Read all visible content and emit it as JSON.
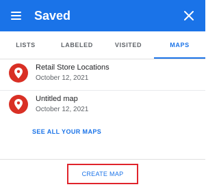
{
  "header": {
    "title": "Saved",
    "menu_icon": "hamburger-menu-icon",
    "close_icon": "close-icon",
    "background_color": "#1a73e8"
  },
  "tabs": [
    {
      "label": "LISTS",
      "active": false
    },
    {
      "label": "LABELED",
      "active": false
    },
    {
      "label": "VISITED",
      "active": false
    },
    {
      "label": "MAPS",
      "active": true
    }
  ],
  "maps": [
    {
      "name": "Retail Store Locations",
      "date": "October 12, 2021",
      "icon": "map-pin-icon"
    },
    {
      "name": "Untitled map",
      "date": "October 12, 2021",
      "icon": "map-pin-icon"
    }
  ],
  "see_all_label": "SEE ALL YOUR MAPS",
  "create_map_label": "CREATE MAP",
  "colors": {
    "accent": "#1a73e8",
    "pin": "#d93025",
    "highlight_box": "#e0232b"
  }
}
